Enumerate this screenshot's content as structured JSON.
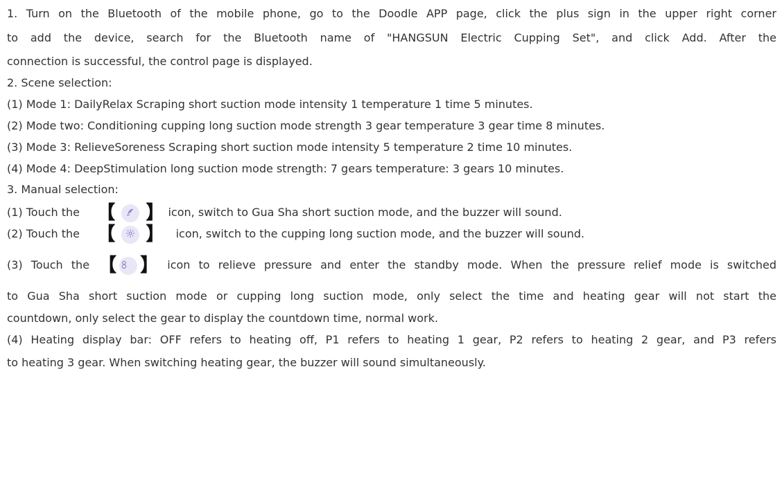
{
  "lines": [
    "1. Turn on the Bluetooth of the mobile phone, go to the Doodle APP page, click the plus sign in the upper right corner",
    "to add the device, search for the Bluetooth name of \"HANGSUN Electric Cupping Set\", and click Add. After the",
    "connection is successful, the control page is displayed.",
    "2. Scene selection:",
    "(1) Mode 1: DailyRelax Scraping short suction mode intensity 1 temperature 1 time 5 minutes.",
    "(2) Mode two: Conditioning cupping long suction mode strength 3 gear temperature 3 gear time 8 minutes.",
    "(3) Mode 3: RelieveSoreness Scraping short suction mode intensity 5 temperature 2 time 10 minutes.",
    "(4) Mode 4: DeepStimulation long suction mode strength: 7 gears temperature: 3 gears 10 minutes.",
    "3. Manual selection:"
  ],
  "manual": {
    "item1_pre": "(1) Touch the",
    "item1_post": "icon, switch to Gua Sha short suction mode, and the buzzer will sound.",
    "item2_pre": "(2) Touch the",
    "item2_post": "icon, switch to the cupping long suction mode, and the buzzer will sound.",
    "item3_pre": "(3) Touch the",
    "item3_post": "icon to relieve pressure and enter the standby mode. When the pressure relief mode is switched",
    "bracket_open": "【",
    "bracket_close": "】"
  },
  "icons": {
    "gua_sha": "gua-sha-icon",
    "cupping": "cupping-icon",
    "relief": "pressure-relief-icon"
  },
  "tail_lines": [
    "to Gua Sha short suction mode or cupping long suction mode, only select the time and heating gear will not start the",
    "countdown, only select the gear to display the countdown time, normal work.",
    "(4) Heating display bar: OFF refers to heating off, P1 refers to heating 1 gear, P2 refers to heating 2 gear, and P3 refers",
    "to heating 3 gear. When switching heating gear, the buzzer will sound simultaneously."
  ],
  "colors": {
    "text": "#333333",
    "icon_bg": "#e9e7f6",
    "icon_fg": "#8d88c9"
  }
}
